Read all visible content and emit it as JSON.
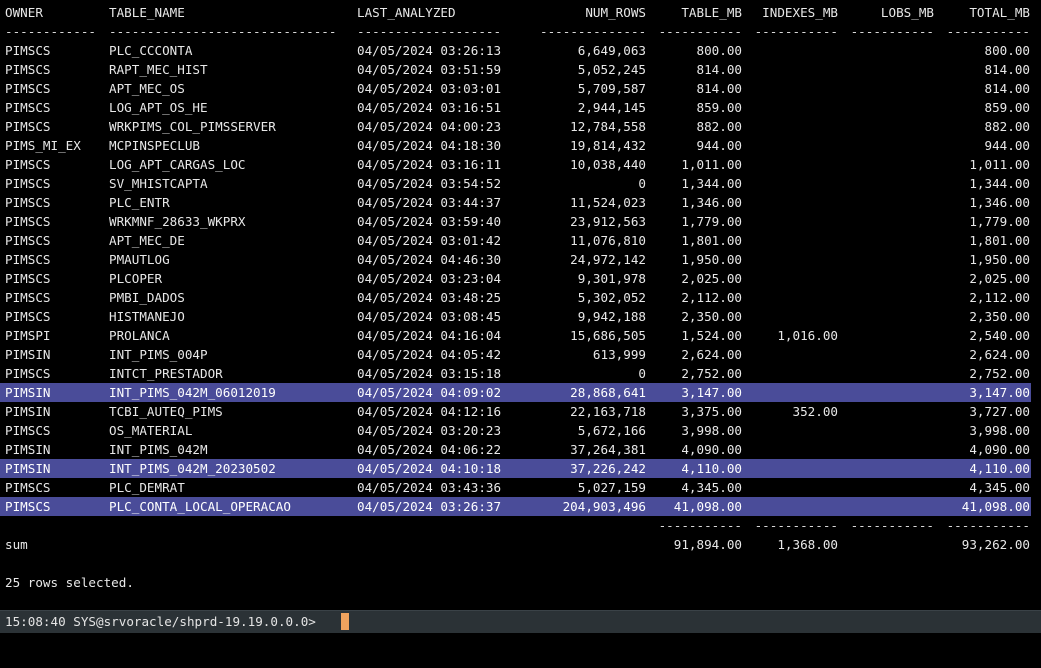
{
  "columns": {
    "owner": "OWNER",
    "table_name": "TABLE_NAME",
    "last_analyzed": "LAST_ANALYZED",
    "num_rows": "NUM_ROWS",
    "table_mb": "TABLE_MB",
    "indexes_mb": "INDEXES_MB",
    "lobs_mb": "LOBS_MB",
    "total_mb": "TOTAL_MB"
  },
  "header_dashes": {
    "owner": "------------",
    "table_name": "------------------------------",
    "last_analyzed": "-------------------",
    "num_rows": "----------------",
    "table_mb": "-----------",
    "indexes_mb": "-----------",
    "lobs_mb": "-----------",
    "total_mb": "-----------"
  },
  "rows": [
    {
      "owner": "PIMSCS",
      "table_name": "PLC_CCCONTA",
      "last_analyzed": "04/05/2024 03:26:13",
      "num_rows": "6,649,063",
      "table_mb": "800.00",
      "indexes_mb": "",
      "lobs_mb": "",
      "total_mb": "800.00",
      "highlight": false
    },
    {
      "owner": "PIMSCS",
      "table_name": "RAPT_MEC_HIST",
      "last_analyzed": "04/05/2024 03:51:59",
      "num_rows": "5,052,245",
      "table_mb": "814.00",
      "indexes_mb": "",
      "lobs_mb": "",
      "total_mb": "814.00",
      "highlight": false
    },
    {
      "owner": "PIMSCS",
      "table_name": "APT_MEC_OS",
      "last_analyzed": "04/05/2024 03:03:01",
      "num_rows": "5,709,587",
      "table_mb": "814.00",
      "indexes_mb": "",
      "lobs_mb": "",
      "total_mb": "814.00",
      "highlight": false
    },
    {
      "owner": "PIMSCS",
      "table_name": "LOG_APT_OS_HE",
      "last_analyzed": "04/05/2024 03:16:51",
      "num_rows": "2,944,145",
      "table_mb": "859.00",
      "indexes_mb": "",
      "lobs_mb": "",
      "total_mb": "859.00",
      "highlight": false
    },
    {
      "owner": "PIMSCS",
      "table_name": "WRKPIMS_COL_PIMSSERVER",
      "last_analyzed": "04/05/2024 04:00:23",
      "num_rows": "12,784,558",
      "table_mb": "882.00",
      "indexes_mb": "",
      "lobs_mb": "",
      "total_mb": "882.00",
      "highlight": false
    },
    {
      "owner": "PIMS_MI_EX",
      "table_name": "MCPINSPECLUB",
      "last_analyzed": "04/05/2024 04:18:30",
      "num_rows": "19,814,432",
      "table_mb": "944.00",
      "indexes_mb": "",
      "lobs_mb": "",
      "total_mb": "944.00",
      "highlight": false
    },
    {
      "owner": "PIMSCS",
      "table_name": "LOG_APT_CARGAS_LOC",
      "last_analyzed": "04/05/2024 03:16:11",
      "num_rows": "10,038,440",
      "table_mb": "1,011.00",
      "indexes_mb": "",
      "lobs_mb": "",
      "total_mb": "1,011.00",
      "highlight": false
    },
    {
      "owner": "PIMSCS",
      "table_name": "SV_MHISTCAPTA",
      "last_analyzed": "04/05/2024 03:54:52",
      "num_rows": "0",
      "table_mb": "1,344.00",
      "indexes_mb": "",
      "lobs_mb": "",
      "total_mb": "1,344.00",
      "highlight": false
    },
    {
      "owner": "PIMSCS",
      "table_name": "PLC_ENTR",
      "last_analyzed": "04/05/2024 03:44:37",
      "num_rows": "11,524,023",
      "table_mb": "1,346.00",
      "indexes_mb": "",
      "lobs_mb": "",
      "total_mb": "1,346.00",
      "highlight": false
    },
    {
      "owner": "PIMSCS",
      "table_name": "WRKMNF_28633_WKPRX",
      "last_analyzed": "04/05/2024 03:59:40",
      "num_rows": "23,912,563",
      "table_mb": "1,779.00",
      "indexes_mb": "",
      "lobs_mb": "",
      "total_mb": "1,779.00",
      "highlight": false
    },
    {
      "owner": "PIMSCS",
      "table_name": "APT_MEC_DE",
      "last_analyzed": "04/05/2024 03:01:42",
      "num_rows": "11,076,810",
      "table_mb": "1,801.00",
      "indexes_mb": "",
      "lobs_mb": "",
      "total_mb": "1,801.00",
      "highlight": false
    },
    {
      "owner": "PIMSCS",
      "table_name": "PMAUTLOG",
      "last_analyzed": "04/05/2024 04:46:30",
      "num_rows": "24,972,142",
      "table_mb": "1,950.00",
      "indexes_mb": "",
      "lobs_mb": "",
      "total_mb": "1,950.00",
      "highlight": false
    },
    {
      "owner": "PIMSCS",
      "table_name": "PLCOPER",
      "last_analyzed": "04/05/2024 03:23:04",
      "num_rows": "9,301,978",
      "table_mb": "2,025.00",
      "indexes_mb": "",
      "lobs_mb": "",
      "total_mb": "2,025.00",
      "highlight": false
    },
    {
      "owner": "PIMSCS",
      "table_name": "PMBI_DADOS",
      "last_analyzed": "04/05/2024 03:48:25",
      "num_rows": "5,302,052",
      "table_mb": "2,112.00",
      "indexes_mb": "",
      "lobs_mb": "",
      "total_mb": "2,112.00",
      "highlight": false
    },
    {
      "owner": "PIMSCS",
      "table_name": "HISTMANEJO",
      "last_analyzed": "04/05/2024 03:08:45",
      "num_rows": "9,942,188",
      "table_mb": "2,350.00",
      "indexes_mb": "",
      "lobs_mb": "",
      "total_mb": "2,350.00",
      "highlight": false
    },
    {
      "owner": "PIMSPI",
      "table_name": "PROLANCA",
      "last_analyzed": "04/05/2024 04:16:04",
      "num_rows": "15,686,505",
      "table_mb": "1,524.00",
      "indexes_mb": "1,016.00",
      "lobs_mb": "",
      "total_mb": "2,540.00",
      "highlight": false
    },
    {
      "owner": "PIMSIN",
      "table_name": "INT_PIMS_004P",
      "last_analyzed": "04/05/2024 04:05:42",
      "num_rows": "613,999",
      "table_mb": "2,624.00",
      "indexes_mb": "",
      "lobs_mb": "",
      "total_mb": "2,624.00",
      "highlight": false
    },
    {
      "owner": "PIMSCS",
      "table_name": "INTCT_PRESTADOR",
      "last_analyzed": "04/05/2024 03:15:18",
      "num_rows": "0",
      "table_mb": "2,752.00",
      "indexes_mb": "",
      "lobs_mb": "",
      "total_mb": "2,752.00",
      "highlight": false
    },
    {
      "owner": "PIMSIN",
      "table_name": "INT_PIMS_042M_06012019",
      "last_analyzed": "04/05/2024 04:09:02",
      "num_rows": "28,868,641",
      "table_mb": "3,147.00",
      "indexes_mb": "",
      "lobs_mb": "",
      "total_mb": "3,147.00",
      "highlight": true
    },
    {
      "owner": "PIMSIN",
      "table_name": "TCBI_AUTEQ_PIMS",
      "last_analyzed": "04/05/2024 04:12:16",
      "num_rows": "22,163,718",
      "table_mb": "3,375.00",
      "indexes_mb": "352.00",
      "lobs_mb": "",
      "total_mb": "3,727.00",
      "highlight": false
    },
    {
      "owner": "PIMSCS",
      "table_name": "OS_MATERIAL",
      "last_analyzed": "04/05/2024 03:20:23",
      "num_rows": "5,672,166",
      "table_mb": "3,998.00",
      "indexes_mb": "",
      "lobs_mb": "",
      "total_mb": "3,998.00",
      "highlight": false
    },
    {
      "owner": "PIMSIN",
      "table_name": "INT_PIMS_042M",
      "last_analyzed": "04/05/2024 04:06:22",
      "num_rows": "37,264,381",
      "table_mb": "4,090.00",
      "indexes_mb": "",
      "lobs_mb": "",
      "total_mb": "4,090.00",
      "highlight": false
    },
    {
      "owner": "PIMSIN",
      "table_name": "INT_PIMS_042M_20230502",
      "last_analyzed": "04/05/2024 04:10:18",
      "num_rows": "37,226,242",
      "table_mb": "4,110.00",
      "indexes_mb": "",
      "lobs_mb": "",
      "total_mb": "4,110.00",
      "highlight": true
    },
    {
      "owner": "PIMSCS",
      "table_name": "PLC_DEMRAT",
      "last_analyzed": "04/05/2024 03:43:36",
      "num_rows": "5,027,159",
      "table_mb": "4,345.00",
      "indexes_mb": "",
      "lobs_mb": "",
      "total_mb": "4,345.00",
      "highlight": false
    },
    {
      "owner": "PIMSCS",
      "table_name": "PLC_CONTA_LOCAL_OPERACAO",
      "last_analyzed": "04/05/2024 03:26:37",
      "num_rows": "204,903,496",
      "table_mb": "41,098.00",
      "indexes_mb": "",
      "lobs_mb": "",
      "total_mb": "41,098.00",
      "highlight": true
    }
  ],
  "sum_dashes": {
    "table_mb": "-----------",
    "indexes_mb": "-----------",
    "lobs_mb": "-----------",
    "total_mb": "-----------"
  },
  "sum": {
    "label": "sum",
    "table_mb": "91,894.00",
    "indexes_mb": "1,368.00",
    "lobs_mb": "",
    "total_mb": "93,262.00"
  },
  "message": "25 rows selected.",
  "statusbar": {
    "prompt": "15:08:40 SYS@srvoracle/shprd-19.19.0.0.0>"
  },
  "colors": {
    "background": "#000000",
    "text": "#e8e8e8",
    "highlight": "#4a4c99",
    "statusbar": "#2b3236",
    "cursor": "#f0a35e"
  }
}
